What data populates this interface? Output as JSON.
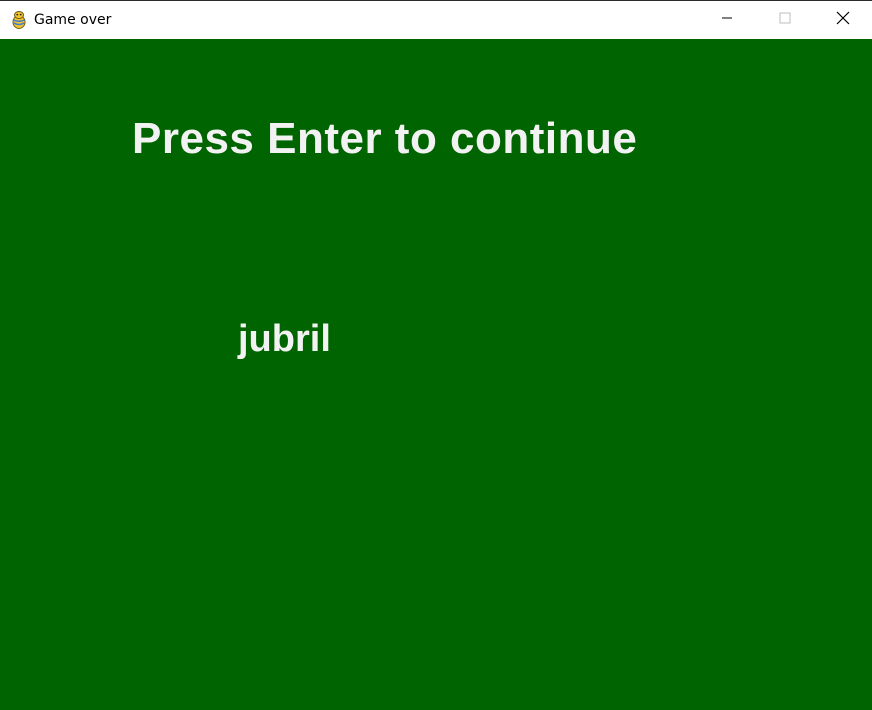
{
  "window": {
    "title": "Game over",
    "icon": "pygame-snake-icon",
    "controls": {
      "minimize_icon": "minimize-icon",
      "maximize_icon": "maximize-icon",
      "close_icon": "close-icon"
    }
  },
  "game": {
    "background_color": "#006400",
    "text_color": "#f2f2f2",
    "prompt": "Press Enter to continue",
    "player_name": "jubril"
  }
}
